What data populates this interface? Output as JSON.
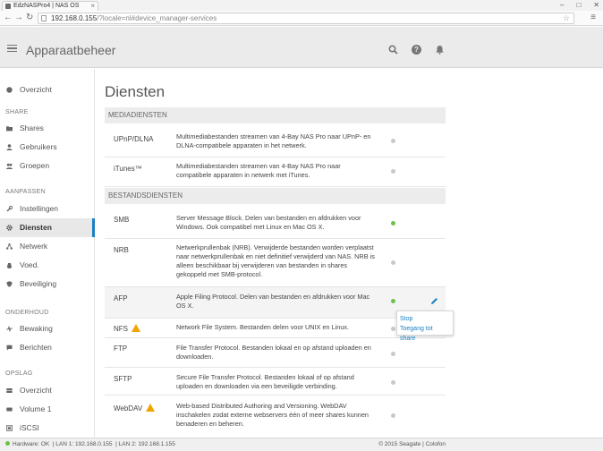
{
  "browser": {
    "tab_title": "EdzNASPro4 | NAS OS",
    "address_host": "192.168.0.155",
    "address_path": "/?locale=nl#device_manager-services"
  },
  "header": {
    "title": "Apparaatbeheer",
    "help_glyph": "?"
  },
  "sidebar": {
    "items_top": [
      {
        "label": "Overzicht",
        "icon": "overview-icon"
      }
    ],
    "section_share": "SHARE",
    "share_items": [
      {
        "label": "Shares",
        "icon": "folder-icon"
      },
      {
        "label": "Gebruikers",
        "icon": "user-icon"
      },
      {
        "label": "Groepen",
        "icon": "group-icon"
      }
    ],
    "section_customize": "AANPASSEN",
    "customize_items": [
      {
        "label": "Instellingen",
        "icon": "wrench-icon"
      },
      {
        "label": "Diensten",
        "icon": "gear-icon",
        "active": true
      },
      {
        "label": "Netwerk",
        "icon": "network-icon"
      },
      {
        "label": "Voed.",
        "icon": "power-icon"
      },
      {
        "label": "Beveiliging",
        "icon": "shield-icon"
      }
    ],
    "section_maintenance": "ONDERHOUD",
    "maintenance_items": [
      {
        "label": "Bewaking",
        "icon": "monitor-icon"
      },
      {
        "label": "Berichten",
        "icon": "messages-icon"
      }
    ],
    "section_storage": "OPSLAG",
    "storage_items": [
      {
        "label": "Overzicht",
        "icon": "storage-icon"
      },
      {
        "label": "Volume 1",
        "icon": "volume-icon"
      },
      {
        "label": "iSCSI",
        "icon": "iscsi-icon"
      }
    ]
  },
  "main": {
    "title": "Diensten",
    "media_section": "MEDIADIENSTEN",
    "media_services": [
      {
        "name": "UPnP/DLNA",
        "desc": "Multimediabestanden streamen van 4-Bay NAS Pro naar UPnP- en DLNA-compatibele apparaten in het netwerk.",
        "status": "off"
      },
      {
        "name": "iTunes™",
        "desc": "Multimediabestanden streamen van 4-Bay NAS Pro naar compatibele apparaten in netwerk met iTunes.",
        "status": "off"
      }
    ],
    "file_section": "BESTANDSDIENSTEN",
    "file_services": [
      {
        "name": "SMB",
        "desc": "Server Message Block. Delen van bestanden en afdrukken voor Windows. Ook compatibel met Linux en Mac OS X.",
        "status": "on"
      },
      {
        "name": "NRB",
        "desc": "Netwerkprullenbak (NRB). Verwijderde bestanden worden verplaatst naar netwerkprullenbak en niet definitief verwijderd van NAS. NRB is alleen beschikbaar bij verwijderen van bestanden in shares gekoppeld met SMB-protocol.",
        "status": "off"
      },
      {
        "name": "AFP",
        "desc": "Apple Filing Protocol. Delen van bestanden en afdrukken voor Mac OS X.",
        "status": "on"
      },
      {
        "name": "NFS",
        "desc": "Network File System. Bestanden delen voor UNIX en Linux.",
        "status": "off",
        "warning": true
      },
      {
        "name": "FTP",
        "desc": "File Transfer Protocol. Bestanden lokaal en op afstand uploaden en downloaden.",
        "status": "off"
      },
      {
        "name": "SFTP",
        "desc": "Secure File Transfer Protocol. Bestanden lokaal of op afstand uploaden en downloaden via een beveiligde verbinding.",
        "status": "off"
      },
      {
        "name": "WebDAV",
        "desc": "Web-based Distributed Authoring and Versioning. WebDAV inschakelen zodat externe webservers één of meer shares kunnen benaderen en beheren.",
        "status": "off",
        "warning": true
      }
    ],
    "popup": {
      "stop": "Stop",
      "share_access": "Toegang tot share"
    }
  },
  "statusbar": {
    "hardware": "Hardware: OK",
    "lan1": "LAN 1: 192.168.0.155",
    "lan2": "LAN 2: 192.168.1.155",
    "copyright": "© 2015 Seagate | Colofon"
  },
  "colors": {
    "accent": "#1a80c4",
    "status_on": "#6cc24a",
    "status_off": "#c8c8c8",
    "warning": "#f0a400"
  }
}
